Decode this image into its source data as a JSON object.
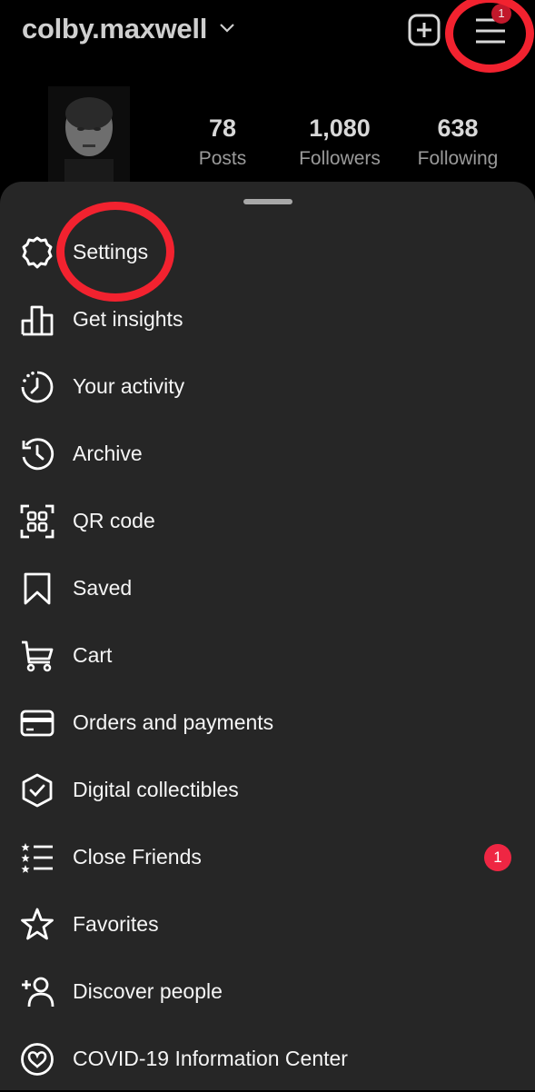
{
  "header": {
    "username": "colby.maxwell",
    "menu_badge": "1"
  },
  "profile": {
    "stats": [
      {
        "value": "78",
        "label": "Posts"
      },
      {
        "value": "1,080",
        "label": "Followers"
      },
      {
        "value": "638",
        "label": "Following"
      }
    ]
  },
  "menu": {
    "items": [
      {
        "label": "Settings",
        "icon": "settings-icon"
      },
      {
        "label": "Get insights",
        "icon": "insights-icon"
      },
      {
        "label": "Your activity",
        "icon": "activity-icon"
      },
      {
        "label": "Archive",
        "icon": "archive-icon"
      },
      {
        "label": "QR code",
        "icon": "qr-code-icon"
      },
      {
        "label": "Saved",
        "icon": "bookmark-icon"
      },
      {
        "label": "Cart",
        "icon": "cart-icon"
      },
      {
        "label": "Orders and payments",
        "icon": "card-icon"
      },
      {
        "label": "Digital collectibles",
        "icon": "shield-check-icon"
      },
      {
        "label": "Close Friends",
        "icon": "close-friends-list-icon",
        "badge": "1"
      },
      {
        "label": "Favorites",
        "icon": "star-icon"
      },
      {
        "label": "Discover people",
        "icon": "add-person-icon"
      },
      {
        "label": "COVID-19 Information Center",
        "icon": "heart-person-icon"
      }
    ]
  },
  "colors": {
    "background": "#000000",
    "sheet": "#262626",
    "annotation_red": "#f2222f",
    "badge_red": "#ef2643"
  }
}
